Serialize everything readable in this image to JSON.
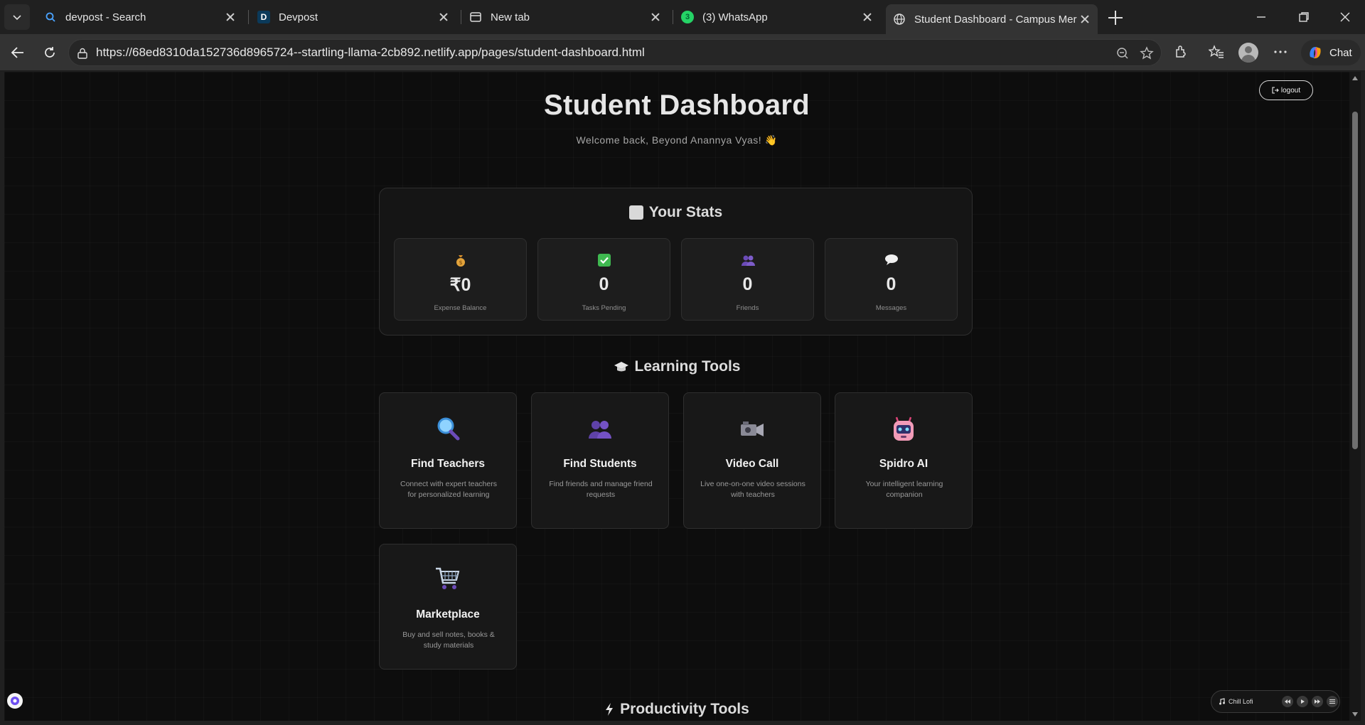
{
  "browser": {
    "tabs": [
      {
        "title": "devpost - Search",
        "icon": "search-icon"
      },
      {
        "title": "Devpost",
        "icon": "devpost-logo",
        "letter": "D"
      },
      {
        "title": "New tab",
        "icon": "new-tab-page-icon"
      },
      {
        "title": "(3) WhatsApp",
        "icon": "whatsapp-icon",
        "badge": "3"
      },
      {
        "title": "Student Dashboard - Campus Mer",
        "icon": "globe-icon",
        "active": true
      }
    ],
    "url": "https://68ed8310da152736d8965724--startling-llama-2cb892.netlify.app/pages/student-dashboard.html",
    "chat_label": "Chat"
  },
  "header": {
    "logout_label": "logout",
    "title": "Student Dashboard",
    "welcome": "Welcome back, Beyond Anannya Vyas! 👋"
  },
  "stats": {
    "heading": "Your Stats",
    "cards": [
      {
        "icon": "money-bag-icon",
        "value": "₹0",
        "label": "Expense Balance"
      },
      {
        "icon": "check-icon",
        "value": "0",
        "label": "Tasks Pending"
      },
      {
        "icon": "people-icon",
        "value": "0",
        "label": "Friends"
      },
      {
        "icon": "speech-bubble-icon",
        "value": "0",
        "label": "Messages"
      }
    ]
  },
  "learning": {
    "heading": "Learning Tools",
    "tools": [
      {
        "icon": "magnifier-icon",
        "name": "Find Teachers",
        "desc": "Connect with expert teachers for personalized learning"
      },
      {
        "icon": "people-icon",
        "name": "Find Students",
        "desc": "Find friends and manage friend requests"
      },
      {
        "icon": "video-camera-icon",
        "name": "Video Call",
        "desc": "Live one-on-one video sessions with teachers"
      },
      {
        "icon": "robot-icon",
        "name": "Spidro AI",
        "desc": "Your intelligent learning companion"
      },
      {
        "icon": "shopping-cart-icon",
        "name": "Marketplace",
        "desc": "Buy and sell notes, books & study materials"
      }
    ]
  },
  "productivity": {
    "heading": "Productivity Tools"
  },
  "music_player": {
    "track": "Chill Lofi"
  },
  "colors": {
    "page_bg": "#0d0d0d",
    "card_bg": "#181818",
    "border": "#2f2f2f",
    "accent_purple": "#7b4fd1"
  }
}
